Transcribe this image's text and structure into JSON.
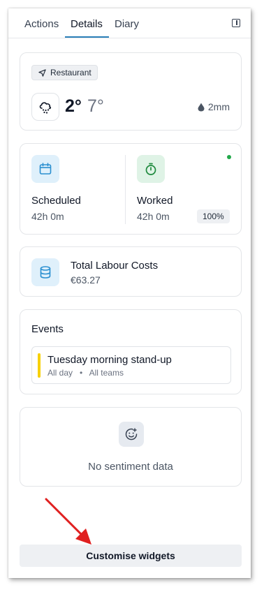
{
  "tabs": [
    {
      "label": "Actions"
    },
    {
      "label": "Details"
    },
    {
      "label": "Diary"
    }
  ],
  "active_tab": "Details",
  "weather": {
    "location": "Restaurant",
    "temp_now": "2°",
    "temp_high": "7°",
    "rain": "2mm",
    "icons": {
      "location": "navigation-arrow-icon",
      "condition": "snow-cloud-icon",
      "rain": "raindrop-icon"
    }
  },
  "hours": {
    "scheduled_label": "Scheduled",
    "scheduled_value": "42h 0m",
    "worked_label": "Worked",
    "worked_value": "42h 0m",
    "worked_pct": "100%",
    "icons": {
      "scheduled": "calendar-icon",
      "worked": "stopwatch-icon"
    },
    "status_color": "#22a84a"
  },
  "labour": {
    "title": "Total Labour Costs",
    "value": "€63.27",
    "icon": "database-icon"
  },
  "events": {
    "title": "Events",
    "items": [
      {
        "name": "Tuesday morning stand-up",
        "duration": "All day",
        "teams": "All teams",
        "color": "#f7d000"
      }
    ]
  },
  "sentiment": {
    "empty_text": "No sentiment data",
    "icon": "smiley-icon"
  },
  "customise_label": "Customise widgets",
  "colors": {
    "accent": "#2a7fb8",
    "annotation": "#e02020"
  }
}
